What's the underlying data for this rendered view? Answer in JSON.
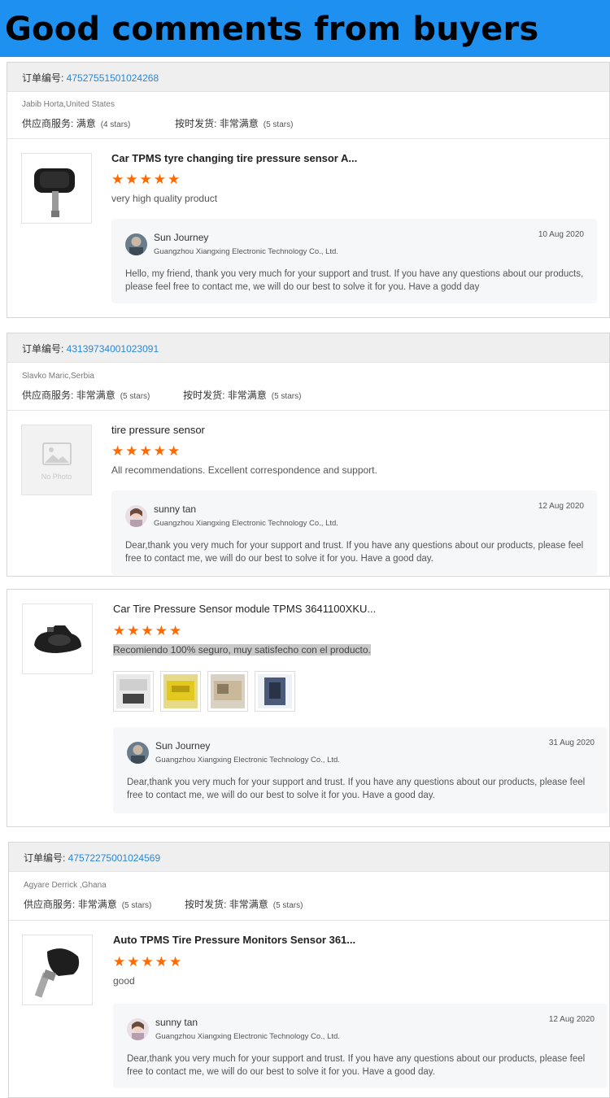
{
  "banner": {
    "title": "Good comments from buyers"
  },
  "common": {
    "order_label": "订单编号: ",
    "company": "Guangzhou Xiangxing Electronic Technology Co., Ltd.",
    "star_glyph": "★",
    "accent_star": "#ff6a00",
    "link_blue": "#2b86d4",
    "banner_blue": "#1e90f0"
  },
  "review1": {
    "order_number": "47527551501024268",
    "buyer": "Jabib Horta,United States",
    "supplier_label": "供应商服务:",
    "supplier_value": "满意",
    "supplier_stars": "(4 stars)",
    "shipping_label": "按时发货:",
    "shipping_value": "非常满意",
    "shipping_stars": "(5 stars)",
    "product_title": "Car TPMS tyre changing tire pressure sensor A...",
    "rating": 5,
    "comment": "very high quality product",
    "reply": {
      "name": "Sun Journey",
      "date": "10 Aug 2020",
      "message": "Hello, my friend, thank you very much for your support and trust. If you have any questions about our products, please feel free to contact me, we will do our best to solve it for you. Have a godd day"
    }
  },
  "review2": {
    "order_number": "43139734001023091",
    "buyer": "Slavko Maric,Serbia",
    "supplier_label": "供应商服务:",
    "supplier_value": "非常满意",
    "supplier_stars": "(5 stars)",
    "shipping_label": "按时发货:",
    "shipping_value": "非常满意",
    "shipping_stars": "(5 stars)",
    "no_photo": "No Photo",
    "product_title": "tire pressure sensor",
    "rating": 5,
    "comment": "All recommendations. Excellent correspondence and support.",
    "reply": {
      "name": "sunny tan",
      "date": "12 Aug 2020",
      "message": "Dear,thank you very much for your support and trust. If you have any questions about our products, please feel free to contact me, we will do our best to solve it for you. Have a good day."
    }
  },
  "review3": {
    "product_title": "Car Tire Pressure Sensor module TPMS 3641100XKU...",
    "rating": 5,
    "comment": "Recomiendo 100% seguro, muy satisfecho con el producto.",
    "reply": {
      "name": "Sun Journey",
      "date": "31 Aug 2020",
      "message": "Dear,thank you very much for your support and trust. If you have any questions about our products, please feel free to contact me, we will do our best to solve it for you. Have a good day."
    }
  },
  "review4": {
    "order_number": "47572275001024569",
    "buyer": "Agyare Derrick ,Ghana",
    "supplier_label": "供应商服务:",
    "supplier_value": "非常满意",
    "supplier_stars": "(5 stars)",
    "shipping_label": "按时发货:",
    "shipping_value": "非常满意",
    "shipping_stars": "(5 stars)",
    "product_title": "Auto TPMS Tire Pressure Monitors Sensor 361...",
    "rating": 5,
    "comment": "good",
    "reply": {
      "name": "sunny tan",
      "date": "12 Aug 2020",
      "message": "Dear,thank you very much for your support and trust. If you have any questions about our products, please feel free to contact me, we will do our best to solve it for you. Have a good day."
    }
  }
}
